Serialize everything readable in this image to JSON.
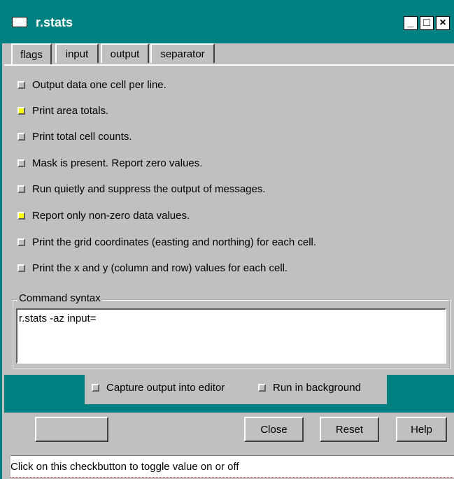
{
  "window": {
    "title": "r.stats",
    "minimize": "_",
    "maximize": "□",
    "close": "×"
  },
  "tabs": [
    {
      "label": "flags",
      "active": true
    },
    {
      "label": "input",
      "active": false
    },
    {
      "label": "output",
      "active": false
    },
    {
      "label": "separator",
      "active": false
    }
  ],
  "flags": [
    {
      "label": "Output data one cell per line.",
      "checked": false
    },
    {
      "label": "Print area totals.",
      "checked": true
    },
    {
      "label": "Print total cell counts.",
      "checked": false
    },
    {
      "label": "Mask is present.  Report zero values.",
      "checked": false
    },
    {
      "label": "Run quietly and suppress the output of messages.",
      "checked": false
    },
    {
      "label": "Report only non-zero data values.",
      "checked": true
    },
    {
      "label": "Print the grid coordinates (easting and northing) for each cell.",
      "checked": false
    },
    {
      "label": "Print the x and y (column and row) values for each cell.",
      "checked": false
    }
  ],
  "command": {
    "label": "Command syntax",
    "text": "r.stats -az input="
  },
  "options": [
    {
      "label": "Capture output into editor",
      "checked": false
    },
    {
      "label": "Run in background",
      "checked": false
    }
  ],
  "buttons": {
    "blank": "",
    "close": "Close",
    "reset": "Reset",
    "help": "Help"
  },
  "status": "Click on this checkbutton to toggle value on or off",
  "colors": {
    "accent": "#008080",
    "checked": "#ffff00",
    "background": "#c0c0c0"
  }
}
